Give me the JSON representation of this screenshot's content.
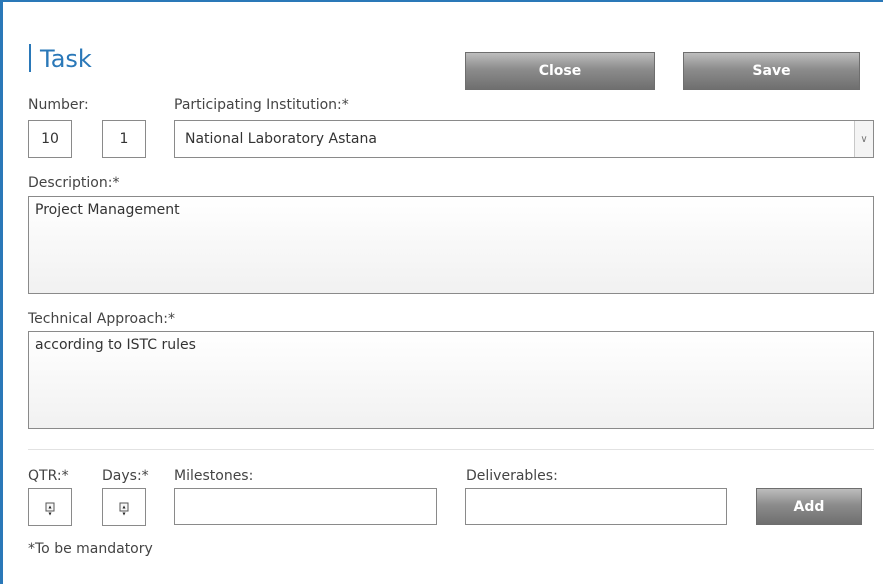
{
  "header": {
    "title": "Task",
    "close_label": "Close",
    "save_label": "Save"
  },
  "number": {
    "label": "Number:",
    "main": "10",
    "sub": "1"
  },
  "institution": {
    "label": "Participating Institution:*",
    "selected": "National Laboratory Astana"
  },
  "description": {
    "label": "Description:*",
    "value": "Project Management"
  },
  "technical": {
    "label": "Technical Approach:*",
    "value": "according to ISTC rules"
  },
  "schedule": {
    "qtr_label": "QTR:*",
    "days_label": "Days:*",
    "milestones_label": "Milestones:",
    "deliverables_label": "Deliverables:",
    "add_label": "Add"
  },
  "footer": {
    "note": "*To be mandatory"
  },
  "colors": {
    "accent": "#2a78b8",
    "button": "#8c8c8c"
  }
}
